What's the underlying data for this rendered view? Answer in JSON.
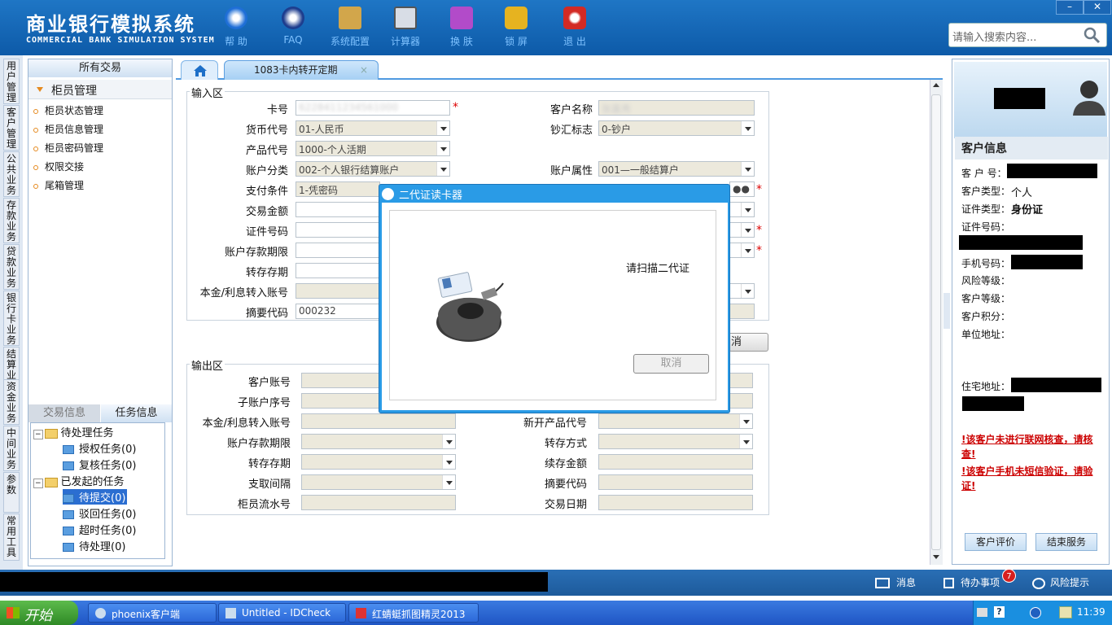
{
  "header": {
    "title_cn": "商业银行模拟系统",
    "title_en": "COMMERCIAL BANK SIMULATION SYSTEM",
    "toolbar": [
      {
        "label": "帮 助",
        "icon": "help-icon"
      },
      {
        "label": "FAQ",
        "icon": "faq-icon"
      },
      {
        "label": "系统配置",
        "icon": "config-icon"
      },
      {
        "label": "计算器",
        "icon": "calculator-icon"
      },
      {
        "label": "换 肤",
        "icon": "skin-icon"
      },
      {
        "label": "锁 屏",
        "icon": "lock-icon"
      },
      {
        "label": "退 出",
        "icon": "exit-icon"
      }
    ],
    "search_placeholder": "请输入搜索内容...",
    "min": "–",
    "close": "✕"
  },
  "vtabs": [
    "用户管理",
    "客户管理",
    "公共业务",
    "存款业务",
    "贷款业务",
    "银行卡业务",
    "结算业务",
    "资金业务",
    "中间业务",
    "参数",
    "常用工具"
  ],
  "left": {
    "header": "所有交易",
    "group": "柜员管理",
    "items": [
      "柜员状态管理",
      "柜员信息管理",
      "柜员密码管理",
      "权限交接",
      "尾箱管理"
    ],
    "tabs": [
      "交易信息",
      "任务信息"
    ],
    "tree": {
      "pending": "待处理任务",
      "auth": "授权任务(0)",
      "review": "复核任务(0)",
      "initiated": "已发起的任务",
      "submit": "待提交(0)",
      "rejected": "驳回任务(0)",
      "timeout": "超时任务(0)",
      "waiting": "待处理(0)"
    }
  },
  "tabs": {
    "active": "1083卡内转开定期",
    "close": "×"
  },
  "input": {
    "title": "输入区",
    "card_no_label": "卡号",
    "card_no": "6228411234561000",
    "cust_name_label": "客户名称",
    "cust_name": "张嘉秀",
    "currency_label": "货币代号",
    "currency": "01-人民币",
    "cash_label": "钞汇标志",
    "cash": "0-钞户",
    "product_label": "产品代号",
    "product": "1000-个人活期",
    "acct_class_label": "账户分类",
    "acct_class": "002-个人银行结算账户",
    "acct_attr_label": "账户属性",
    "acct_attr": "001—一般结算户",
    "pay_label": "支付条件",
    "pay": "1-凭密码",
    "amount_label": "交易金额",
    "id_label": "证件号码",
    "term_label": "账户存款期限",
    "renew_label": "转存存期",
    "interest_label": "本金/利息转入账号",
    "summary_label": "摘要代码",
    "summary": "000232",
    "pwd": "●●",
    "cancel_frag": "消"
  },
  "output": {
    "title": "输出区",
    "cust_acct": "客户账号",
    "sub_seq": "子账户序号",
    "interest": "本金/利息转入账号",
    "term": "账户存款期限",
    "renew": "转存存期",
    "withdraw": "支取间隔",
    "teller": "柜员流水号",
    "new_product": "新开产品代号",
    "renew_mode": "转存方式",
    "renew_amt": "续存金额",
    "summary": "摘要代码",
    "date": "交易日期"
  },
  "right": {
    "title": "客户信息",
    "cust_no": "客 户 号：",
    "cust_type": "客户类型：",
    "cust_type_val": "个人",
    "id_type": "证件类型：",
    "id_type_val": "身份证",
    "id_no": "证件号码：",
    "phone": "手机号码：",
    "risk": "风险等级：",
    "level": "客户等级：",
    "points": "客户积分：",
    "company": "单位地址：",
    "home": "住宅地址：",
    "warn1": "!该客户未进行联网核查，请核查!",
    "warn2": "!该客户手机未短信验证，请验证!",
    "btn_eval": "客户评价",
    "btn_end": "结束服务"
  },
  "status": {
    "msg": "消息",
    "todo": "待办事项",
    "todo_count": "7",
    "risk": "风险提示"
  },
  "taskbar": {
    "start": "开始",
    "tasks": [
      "phoenix客户端",
      "Untitled - IDCheck",
      "红蜻蜓抓图精灵2013"
    ],
    "time": "11:39"
  },
  "dialog": {
    "title": "二代证读卡器",
    "msg": "请扫描二代证",
    "cancel": "取消"
  }
}
